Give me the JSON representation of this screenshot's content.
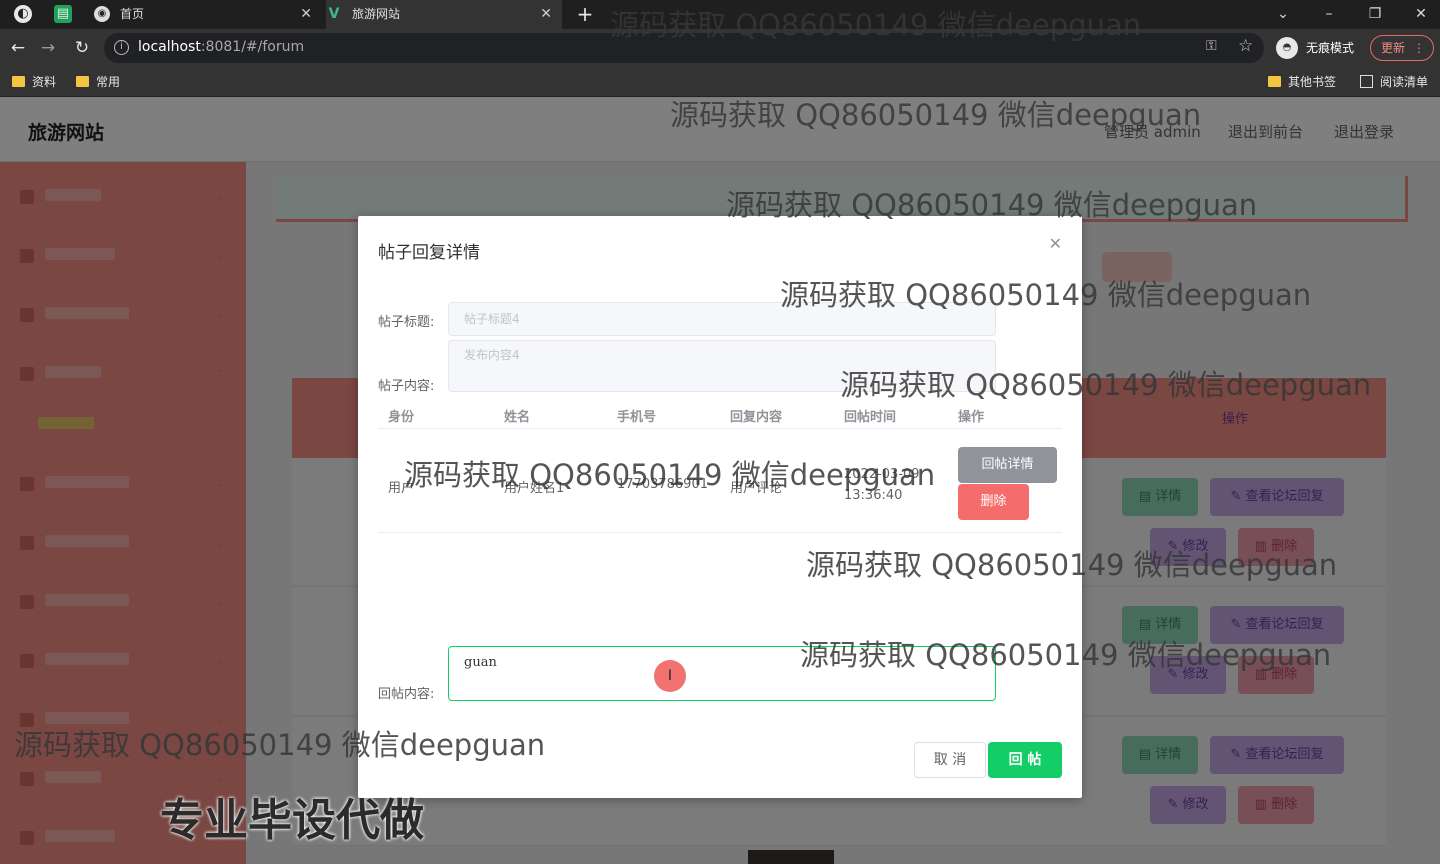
{
  "browser": {
    "tabs": [
      {
        "label": "首页",
        "icon": "globe-icon"
      },
      {
        "label": "旅游网站",
        "icon": "vue-logo-icon"
      }
    ],
    "url_host": "localhost",
    "url_rest": ":8081/#/forum",
    "incognito_label": "无痕模式",
    "update_label": "更新",
    "bookmarks": [
      "资料",
      "常用"
    ],
    "bookmarks_right": [
      "其他书签",
      "阅读清单"
    ]
  },
  "site": {
    "title": "旅游网站",
    "user_label": "管理员 admin",
    "back_to_front": "退出到前台",
    "logout": "退出登录",
    "table_op_header": "操作"
  },
  "row_buttons": {
    "detail": "详情",
    "view_replies": "查看论坛回复",
    "edit": "修改",
    "delete": "删除"
  },
  "dialog": {
    "title": "帖子回复详情",
    "post_title_label": "帖子标题:",
    "post_title_value": "帖子标题4",
    "post_content_label": "帖子内容:",
    "post_content_value": "发布内容4",
    "columns": [
      "身份",
      "姓名",
      "手机号",
      "回复内容",
      "回帖时间",
      "操作"
    ],
    "rows": [
      {
        "role": "用户",
        "name": "用户姓名1",
        "phone": "17703786901",
        "content": "用户评论",
        "time": "2022-03-09 13:36:40",
        "detail_btn": "回帖详情",
        "delete_btn": "删除"
      }
    ],
    "reply_label": "回帖内容:",
    "reply_value": "guan",
    "cancel_label": "取 消",
    "submit_label": "回 帖"
  },
  "watermarks": {
    "text": "源码获取 QQ86050149 微信deepguan",
    "banner": "专业毕设代做"
  },
  "colors": {
    "sidebar": "#f58f85",
    "primary_green": "#13ce66",
    "danger": "#f56c6c"
  }
}
